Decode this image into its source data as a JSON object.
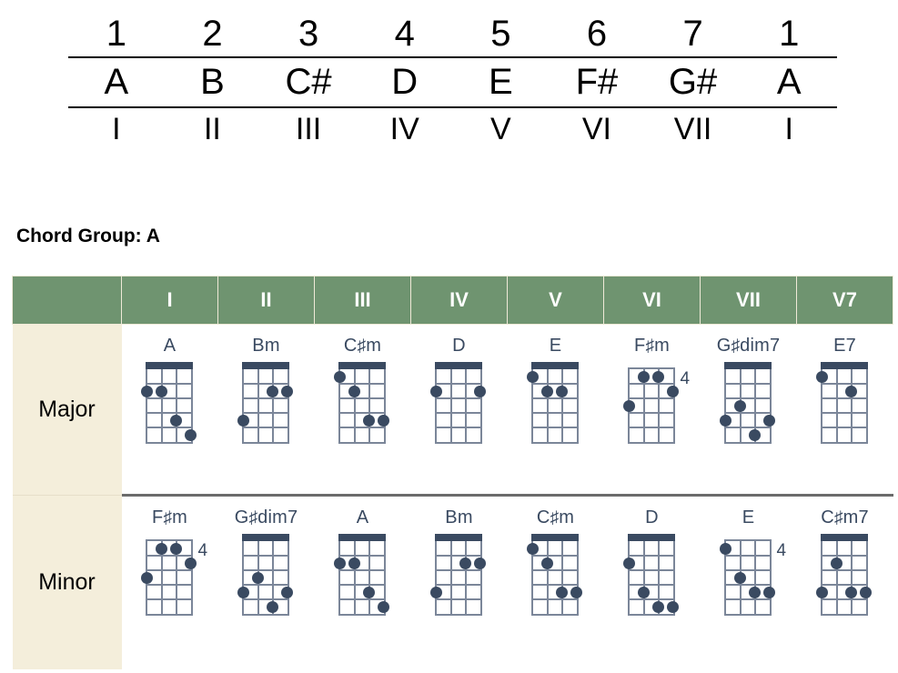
{
  "scale_table": {
    "degrees": [
      "1",
      "2",
      "3",
      "4",
      "5",
      "6",
      "7",
      "1"
    ],
    "notes": [
      "A",
      "B",
      "C#",
      "D",
      "E",
      "F#",
      "G#",
      "A"
    ],
    "romans": [
      "I",
      "II",
      "III",
      "IV",
      "V",
      "VI",
      "VII",
      "I"
    ]
  },
  "chord_group_title": "Chord Group: A",
  "colors": {
    "header_green": "#6f9470",
    "label_cream": "#f4eedb",
    "diagram_dark": "#3a4a61",
    "grid_gray": "#7b8699"
  },
  "table": {
    "corner_header": "",
    "headers": [
      "I",
      "II",
      "III",
      "IV",
      "V",
      "VI",
      "VII",
      "V7"
    ],
    "rows": [
      {
        "label": "Major",
        "chords": [
          {
            "name": "A",
            "strings": 4,
            "frets": 5,
            "open_nut": true,
            "fret_marker": "",
            "dots": [
              {
                "string": 1,
                "fret": 2
              },
              {
                "string": 2,
                "fret": 2
              },
              {
                "string": 3,
                "fret": 4
              },
              {
                "string": 4,
                "fret": 5
              }
            ]
          },
          {
            "name": "Bm",
            "strings": 4,
            "frets": 5,
            "open_nut": true,
            "fret_marker": "",
            "dots": [
              {
                "string": 3,
                "fret": 2
              },
              {
                "string": 4,
                "fret": 2
              },
              {
                "string": 1,
                "fret": 4
              }
            ]
          },
          {
            "name": "C#m",
            "strings": 4,
            "frets": 5,
            "open_nut": true,
            "fret_marker": "",
            "dots": [
              {
                "string": 1,
                "fret": 1
              },
              {
                "string": 2,
                "fret": 2
              },
              {
                "string": 3,
                "fret": 4
              },
              {
                "string": 4,
                "fret": 4
              }
            ]
          },
          {
            "name": "D",
            "strings": 4,
            "frets": 5,
            "open_nut": true,
            "fret_marker": "",
            "dots": [
              {
                "string": 1,
                "fret": 2
              },
              {
                "string": 4,
                "fret": 2
              }
            ]
          },
          {
            "name": "E",
            "strings": 4,
            "frets": 5,
            "open_nut": true,
            "fret_marker": "",
            "dots": [
              {
                "string": 1,
                "fret": 1
              },
              {
                "string": 2,
                "fret": 2
              },
              {
                "string": 3,
                "fret": 2
              }
            ]
          },
          {
            "name": "F#m",
            "strings": 4,
            "frets": 5,
            "open_nut": false,
            "fret_marker": "4",
            "dots": [
              {
                "string": 2,
                "fret": 1
              },
              {
                "string": 3,
                "fret": 1
              },
              {
                "string": 4,
                "fret": 2
              },
              {
                "string": 1,
                "fret": 3
              }
            ]
          },
          {
            "name": "G#dim7",
            "strings": 4,
            "frets": 5,
            "open_nut": true,
            "fret_marker": "",
            "dots": [
              {
                "string": 2,
                "fret": 3
              },
              {
                "string": 1,
                "fret": 4
              },
              {
                "string": 4,
                "fret": 4
              },
              {
                "string": 3,
                "fret": 5
              }
            ]
          },
          {
            "name": "E7",
            "strings": 4,
            "frets": 5,
            "open_nut": true,
            "fret_marker": "",
            "dots": [
              {
                "string": 1,
                "fret": 1
              },
              {
                "string": 3,
                "fret": 2
              }
            ]
          }
        ]
      },
      {
        "label": "Minor",
        "chords": [
          {
            "name": "F#m",
            "strings": 4,
            "frets": 5,
            "open_nut": false,
            "fret_marker": "4",
            "dots": [
              {
                "string": 2,
                "fret": 1
              },
              {
                "string": 3,
                "fret": 1
              },
              {
                "string": 4,
                "fret": 2
              },
              {
                "string": 1,
                "fret": 3
              }
            ]
          },
          {
            "name": "G#dim7",
            "strings": 4,
            "frets": 5,
            "open_nut": true,
            "fret_marker": "",
            "dots": [
              {
                "string": 2,
                "fret": 3
              },
              {
                "string": 1,
                "fret": 4
              },
              {
                "string": 4,
                "fret": 4
              },
              {
                "string": 3,
                "fret": 5
              }
            ]
          },
          {
            "name": "A",
            "strings": 4,
            "frets": 5,
            "open_nut": true,
            "fret_marker": "",
            "dots": [
              {
                "string": 1,
                "fret": 2
              },
              {
                "string": 2,
                "fret": 2
              },
              {
                "string": 3,
                "fret": 4
              },
              {
                "string": 4,
                "fret": 5
              }
            ]
          },
          {
            "name": "Bm",
            "strings": 4,
            "frets": 5,
            "open_nut": true,
            "fret_marker": "",
            "dots": [
              {
                "string": 3,
                "fret": 2
              },
              {
                "string": 4,
                "fret": 2
              },
              {
                "string": 1,
                "fret": 4
              }
            ]
          },
          {
            "name": "C#m",
            "strings": 4,
            "frets": 5,
            "open_nut": true,
            "fret_marker": "",
            "dots": [
              {
                "string": 1,
                "fret": 1
              },
              {
                "string": 2,
                "fret": 2
              },
              {
                "string": 3,
                "fret": 4
              },
              {
                "string": 4,
                "fret": 4
              }
            ]
          },
          {
            "name": "D",
            "strings": 4,
            "frets": 5,
            "open_nut": true,
            "fret_marker": "",
            "dots": [
              {
                "string": 1,
                "fret": 2
              },
              {
                "string": 2,
                "fret": 4
              },
              {
                "string": 3,
                "fret": 5
              },
              {
                "string": 4,
                "fret": 5
              }
            ]
          },
          {
            "name": "E",
            "strings": 4,
            "frets": 5,
            "open_nut": false,
            "fret_marker": "4",
            "dots": [
              {
                "string": 1,
                "fret": 1
              },
              {
                "string": 2,
                "fret": 3
              },
              {
                "string": 3,
                "fret": 4
              },
              {
                "string": 4,
                "fret": 4
              }
            ]
          },
          {
            "name": "C#m7",
            "strings": 4,
            "frets": 5,
            "open_nut": true,
            "fret_marker": "",
            "dots": [
              {
                "string": 2,
                "fret": 2
              },
              {
                "string": 1,
                "fret": 4
              },
              {
                "string": 3,
                "fret": 4
              },
              {
                "string": 4,
                "fret": 4
              }
            ]
          }
        ]
      }
    ]
  }
}
